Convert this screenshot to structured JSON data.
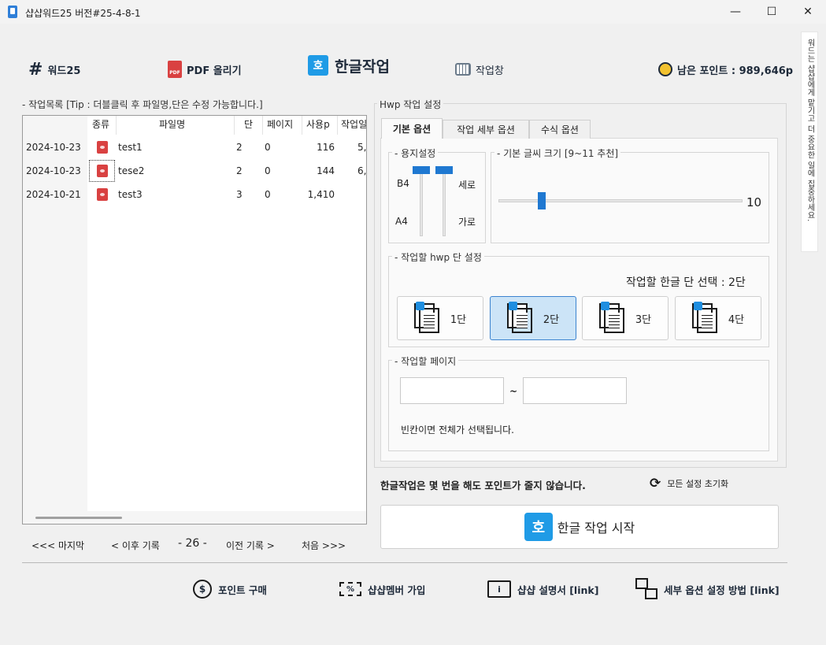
{
  "window": {
    "title": "샵샵워드25  버전#25-4-8-1",
    "minimize": "—",
    "maximize": "☐",
    "close": "✕"
  },
  "topnav": {
    "word25": "워드25",
    "pdf_upload": "PDF 올리기",
    "pdf_badge": "PDF",
    "hangul_work": "한글작업",
    "hangul_glyph": "호",
    "workspace": "작업창",
    "points": "남은 포인트 : 989,646p"
  },
  "side_note": "워드는 샵샵에게 맡기고 더 중요한 일에 집중하세요.",
  "worklist": {
    "legend": "- 작업목록 [Tip : 더블클릭 후 파일명,단은 수정 가능합니다.]",
    "columns": [
      "종류",
      "파일명",
      "단",
      "페이지",
      "사용p",
      "작업일"
    ],
    "rows": [
      {
        "date": "2024-10-23",
        "name": "test1",
        "dan": "2",
        "pages": "0",
        "usedp": "116",
        "extra": "5,"
      },
      {
        "date": "2024-10-23",
        "name": "tese2",
        "dan": "2",
        "pages": "0",
        "usedp": "144",
        "extra": "6,"
      },
      {
        "date": "2024-10-21",
        "name": "test3",
        "dan": "3",
        "pages": "0",
        "usedp": "1,410",
        "extra": ""
      }
    ]
  },
  "pager": {
    "last": "<<< 마지막",
    "next": "< 이후 기록",
    "current": "- 26 -",
    "prev": "이전 기록 >",
    "first": "처음 >>>"
  },
  "settings": {
    "group_title": "Hwp 작업 설정",
    "tabs": [
      "기본 옵션",
      "작업 세부 옵션",
      "수식 옵션"
    ],
    "paper": {
      "legend": "- 용지설정",
      "b4": "B4",
      "a4": "A4",
      "vertical": "세로",
      "horizontal": "가로"
    },
    "font": {
      "legend": "- 기본 글씨 크기 [9~11 추천]",
      "value": "10",
      "min": 9,
      "max": 11,
      "level": 0.18
    },
    "columns": {
      "legend": "- 작업할 hwp 단 설정",
      "selection_label": "작업할 한글 단 선택 : 2단",
      "options": [
        "1단",
        "2단",
        "3단",
        "4단"
      ],
      "selected": "2단"
    },
    "pages": {
      "legend": "- 작업할 페이지",
      "tilde": "~",
      "hint": "빈칸이면 전체가 선택됩니다."
    }
  },
  "notice": "한글작업은 몇 번을 해도 포인트가 줄지 않습니다.",
  "reset": "모든 설정 초기화",
  "start_button": "한글 작업 시작",
  "footer": {
    "buy_points": "포인트 구매",
    "membership": "샵샵멤버 가입",
    "manual": "샵샵 설명서 [link]",
    "options_help": "세부 옵션 설정 방법 [link]"
  },
  "colors": {
    "accent": "#1f78d1",
    "hangul_brand": "#1f9be6",
    "pdf_red": "#d94141",
    "selected_bg": "#cce4f7"
  }
}
